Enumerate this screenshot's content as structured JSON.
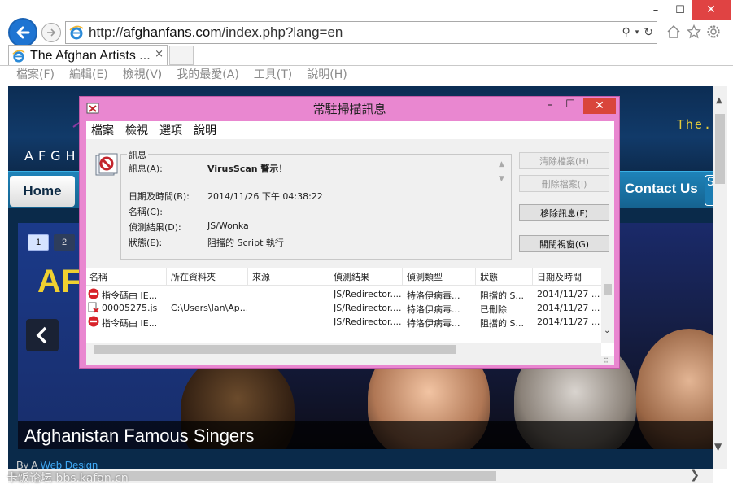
{
  "browser": {
    "url_prefix": "http://",
    "url_host": "afghanfans.com",
    "url_path": "/index.php?lang=en",
    "tab_title": "The Afghan Artists ...",
    "tab_close": "×",
    "window_min": "–",
    "window_max": "☐",
    "window_close": "✕",
    "menu": [
      "檔案(F)",
      "編輯(E)",
      "檢視(V)",
      "我的最愛(A)",
      "工具(T)",
      "說明(H)"
    ]
  },
  "page": {
    "logo_text": "AFGH",
    "header_right": "The.",
    "nav_home": "Home",
    "nav_contact": "Contact Us",
    "nav_search": "S",
    "pager": [
      "1",
      "2"
    ],
    "slide_big_text": "AF",
    "caption": "Afghanistan Famous Singers",
    "byline_prefix": "By A",
    "byline_link": "Web Design"
  },
  "watermark": "卡饭论坛 bbs.kafan.cn",
  "dialog": {
    "title": "常駐掃描訊息",
    "min": "–",
    "max": "☐",
    "close": "✕",
    "menu": [
      "檔案",
      "檢視",
      "選項",
      "說明"
    ],
    "legend": "訊息",
    "fields": [
      {
        "label": "訊息(A):",
        "value": "VirusScan 警示！"
      },
      {
        "label": "日期及時間(B):",
        "value": "2014/11/26 下午 04:38:22"
      },
      {
        "label": "名稱(C):",
        "value": ""
      },
      {
        "label": "偵測結果(D):",
        "value": "JS/Wonka"
      },
      {
        "label": "狀態(E):",
        "value": "阻擋的 Script 執行"
      }
    ],
    "buttons": [
      {
        "label": "清除檔案(H)",
        "enabled": false
      },
      {
        "label": "刪除檔案(I)",
        "enabled": false
      },
      {
        "label": "移除訊息(F)",
        "enabled": true
      },
      {
        "label": "關閉視窗(G)",
        "enabled": true
      }
    ],
    "columns": [
      "名稱",
      "所在資料夾",
      "來源",
      "偵測結果",
      "偵測類型",
      "狀態",
      "日期及時間"
    ],
    "rows": [
      {
        "icon": "blocked-icon",
        "name": "指令碼由 IE...",
        "folder": "",
        "source": "",
        "result": "JS/Redirector....",
        "type": "特洛伊病毒...",
        "status": "阻擋的 S...",
        "date": "2014/11/27 ..."
      },
      {
        "icon": "deleted-file-icon",
        "name": "00005275.js",
        "folder": "C:\\Users\\Ian\\Ap...",
        "source": "",
        "result": "JS/Redirector....",
        "type": "特洛伊病毒...",
        "status": "已刪除",
        "date": "2014/11/27 ..."
      },
      {
        "icon": "blocked-icon",
        "name": "指令碼由 IE...",
        "folder": "",
        "source": "",
        "result": "JS/Redirector....",
        "type": "特洛伊病毒...",
        "status": "阻擋的 S...",
        "date": "2014/11/27 ..."
      }
    ]
  }
}
